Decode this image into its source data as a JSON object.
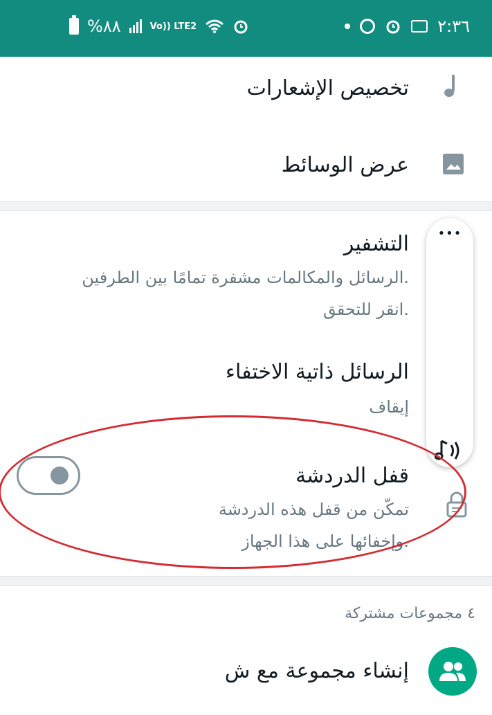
{
  "status_bar": {
    "time": "٢:٣٦",
    "battery_text": "%٨٨",
    "network_label": "Vo)) LTE2"
  },
  "settings": {
    "notifications": {
      "label": "تخصيص الإشعارات",
      "icon": "music-note-icon"
    },
    "media": {
      "label": "عرض الوسائط",
      "icon": "image-icon"
    },
    "encryption": {
      "title": "التشفير",
      "line1": "الرسائل والمكالمات مشفرة تمامًا بين الطرفين.",
      "line2": "انقر للتحقق."
    },
    "disappearing": {
      "title": "الرسائل ذاتية الاختفاء",
      "value": "إيقاف"
    },
    "chat_lock": {
      "title": "قفل الدردشة",
      "line1": "تمكّن من قفل هذه الدردشة",
      "line2": "وإخفائها على هذا الجهاز.",
      "enabled": false,
      "icon": "lock-chat-icon"
    }
  },
  "groups": {
    "header": "٤ مجموعات مشتركة",
    "create_label": "إنشاء مجموعة مع ش",
    "icon": "group-icon"
  },
  "floating_menu": {
    "dots": "•••",
    "icon": "sound-icon"
  },
  "colors": {
    "accent": "#128c7e",
    "green": "#00a884",
    "annotation": "#d22c32"
  }
}
